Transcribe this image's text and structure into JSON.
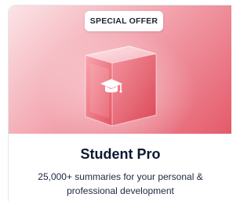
{
  "badge": {
    "label": "SPECIAL OFFER"
  },
  "product": {
    "title": "Student Pro",
    "description": "25,000+ summaries for your personal & professional development",
    "icon": "graduation-cap-icon"
  },
  "colors": {
    "hero_start": "#fbe4e7",
    "hero_end": "#e45a6a",
    "cube_front": "#f0707e",
    "title_text": "#0b1830"
  }
}
